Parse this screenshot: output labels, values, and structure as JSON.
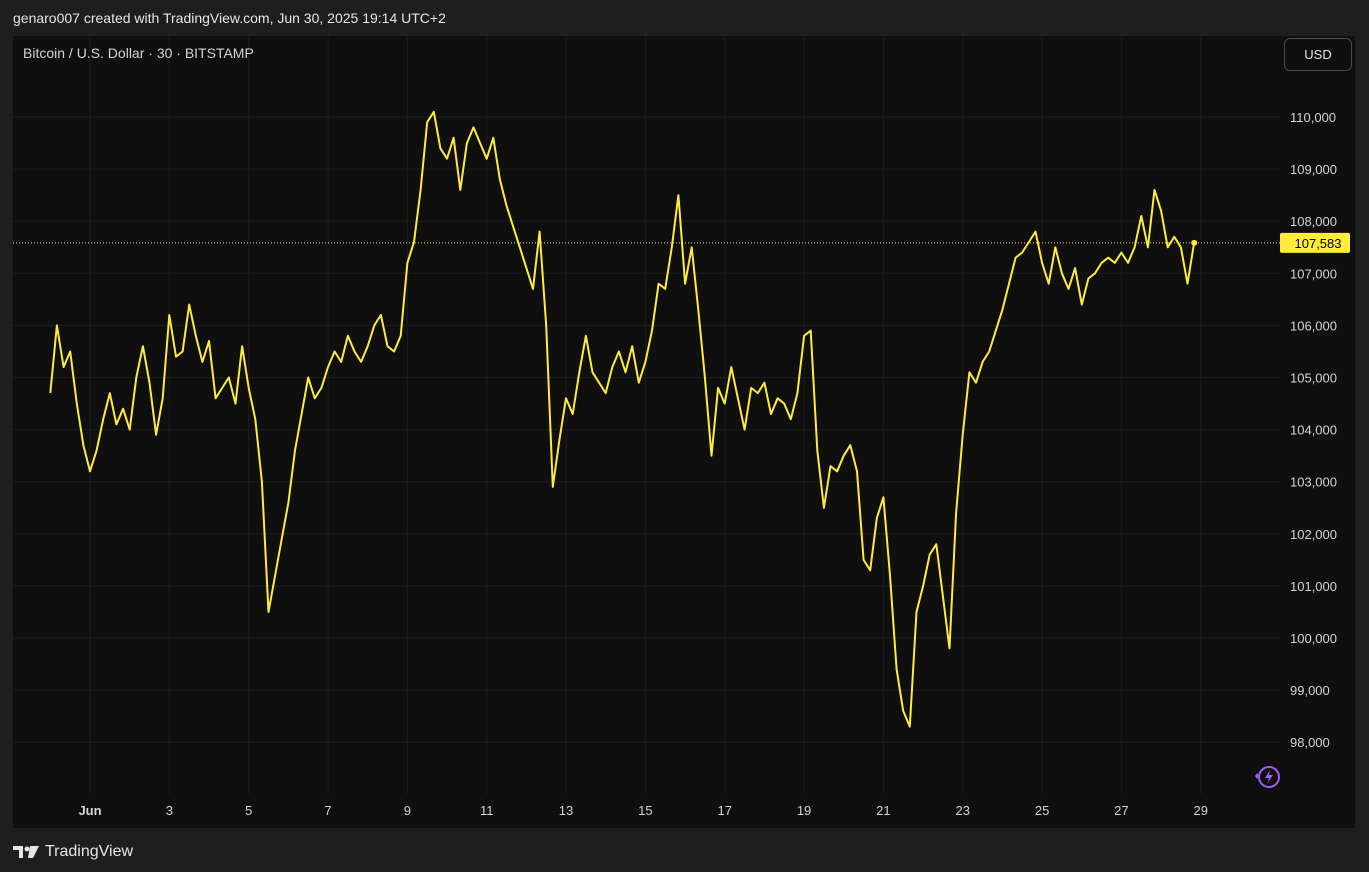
{
  "header": {
    "text": "genaro007 created with TradingView.com, Jun 30, 2025 19:14 UTC+2"
  },
  "chart_title": "Bitcoin / U.S. Dollar · 30 · BITSTAMP",
  "currency_button": "USD",
  "footer": {
    "brand": "TradingView"
  },
  "colors": {
    "line": "#ffeb3b",
    "background": "#0f0f0f",
    "frame": "#1e1e1e",
    "grid": "#1c1c1c",
    "text": "#d1d4dc",
    "price_tag": "#ffeb3b",
    "ai_icon": "#a45cf6"
  },
  "icons": [
    "tradingview-logo-icon",
    "ai-assistant-icon"
  ],
  "chart_data": {
    "type": "line",
    "x_axis_labels": [
      "Jun",
      "3",
      "5",
      "7",
      "9",
      "11",
      "13",
      "15",
      "17",
      "19",
      "21",
      "23",
      "25",
      "27",
      "29"
    ],
    "y_ticks": [
      98000,
      99000,
      100000,
      101000,
      102000,
      103000,
      104000,
      105000,
      106000,
      107000,
      108000,
      109000,
      110000
    ],
    "y_tick_labels": [
      "98,000",
      "99,000",
      "100,000",
      "101,000",
      "102,000",
      "103,000",
      "104,000",
      "105,000",
      "106,000",
      "107,000",
      "108,000",
      "109,000",
      "110,000"
    ],
    "ylim": [
      97000,
      111500
    ],
    "last_price": 107583,
    "last_price_label": "107,583",
    "grid": true,
    "series": [
      {
        "points": [
          [
            "2025-05-31 00:00",
            104700
          ],
          [
            "2025-05-31 04:00",
            106000
          ],
          [
            "2025-05-31 08:00",
            105200
          ],
          [
            "2025-05-31 12:00",
            105500
          ],
          [
            "2025-05-31 16:00",
            104500
          ],
          [
            "2025-05-31 20:00",
            103700
          ],
          [
            "2025-06-01 00:00",
            103200
          ],
          [
            "2025-06-01 04:00",
            103600
          ],
          [
            "2025-06-01 08:00",
            104200
          ],
          [
            "2025-06-01 12:00",
            104700
          ],
          [
            "2025-06-01 16:00",
            104100
          ],
          [
            "2025-06-01 20:00",
            104400
          ],
          [
            "2025-06-02 00:00",
            104000
          ],
          [
            "2025-06-02 04:00",
            105000
          ],
          [
            "2025-06-02 08:00",
            105600
          ],
          [
            "2025-06-02 12:00",
            104900
          ],
          [
            "2025-06-02 16:00",
            103900
          ],
          [
            "2025-06-02 20:00",
            104600
          ],
          [
            "2025-06-03 00:00",
            106200
          ],
          [
            "2025-06-03 04:00",
            105400
          ],
          [
            "2025-06-03 08:00",
            105500
          ],
          [
            "2025-06-03 12:00",
            106400
          ],
          [
            "2025-06-03 16:00",
            105800
          ],
          [
            "2025-06-03 20:00",
            105300
          ],
          [
            "2025-06-04 00:00",
            105700
          ],
          [
            "2025-06-04 04:00",
            104600
          ],
          [
            "2025-06-04 08:00",
            104800
          ],
          [
            "2025-06-04 12:00",
            105000
          ],
          [
            "2025-06-04 16:00",
            104500
          ],
          [
            "2025-06-04 20:00",
            105600
          ],
          [
            "2025-06-05 00:00",
            104800
          ],
          [
            "2025-06-05 04:00",
            104200
          ],
          [
            "2025-06-05 08:00",
            103000
          ],
          [
            "2025-06-05 12:00",
            100500
          ],
          [
            "2025-06-05 16:00",
            101200
          ],
          [
            "2025-06-05 20:00",
            101900
          ],
          [
            "2025-06-06 00:00",
            102600
          ],
          [
            "2025-06-06 04:00",
            103600
          ],
          [
            "2025-06-06 08:00",
            104300
          ],
          [
            "2025-06-06 12:00",
            105000
          ],
          [
            "2025-06-06 16:00",
            104600
          ],
          [
            "2025-06-06 20:00",
            104800
          ],
          [
            "2025-06-07 00:00",
            105200
          ],
          [
            "2025-06-07 04:00",
            105500
          ],
          [
            "2025-06-07 08:00",
            105300
          ],
          [
            "2025-06-07 12:00",
            105800
          ],
          [
            "2025-06-07 16:00",
            105500
          ],
          [
            "2025-06-07 20:00",
            105300
          ],
          [
            "2025-06-08 00:00",
            105600
          ],
          [
            "2025-06-08 04:00",
            106000
          ],
          [
            "2025-06-08 08:00",
            106200
          ],
          [
            "2025-06-08 12:00",
            105600
          ],
          [
            "2025-06-08 16:00",
            105500
          ],
          [
            "2025-06-08 20:00",
            105800
          ],
          [
            "2025-06-09 00:00",
            107200
          ],
          [
            "2025-06-09 04:00",
            107600
          ],
          [
            "2025-06-09 08:00",
            108600
          ],
          [
            "2025-06-09 12:00",
            109900
          ],
          [
            "2025-06-09 16:00",
            110100
          ],
          [
            "2025-06-09 20:00",
            109400
          ],
          [
            "2025-06-10 00:00",
            109200
          ],
          [
            "2025-06-10 04:00",
            109600
          ],
          [
            "2025-06-10 08:00",
            108600
          ],
          [
            "2025-06-10 12:00",
            109500
          ],
          [
            "2025-06-10 16:00",
            109800
          ],
          [
            "2025-06-10 20:00",
            109500
          ],
          [
            "2025-06-11 00:00",
            109200
          ],
          [
            "2025-06-11 04:00",
            109600
          ],
          [
            "2025-06-11 08:00",
            108800
          ],
          [
            "2025-06-11 12:00",
            108300
          ],
          [
            "2025-06-11 16:00",
            107900
          ],
          [
            "2025-06-11 20:00",
            107500
          ],
          [
            "2025-06-12 00:00",
            107100
          ],
          [
            "2025-06-12 04:00",
            106700
          ],
          [
            "2025-06-12 08:00",
            107800
          ],
          [
            "2025-06-12 12:00",
            106000
          ],
          [
            "2025-06-12 16:00",
            102900
          ],
          [
            "2025-06-12 20:00",
            103800
          ],
          [
            "2025-06-13 00:00",
            104600
          ],
          [
            "2025-06-13 04:00",
            104300
          ],
          [
            "2025-06-13 08:00",
            105100
          ],
          [
            "2025-06-13 12:00",
            105800
          ],
          [
            "2025-06-13 16:00",
            105100
          ],
          [
            "2025-06-13 20:00",
            104900
          ],
          [
            "2025-06-14 00:00",
            104700
          ],
          [
            "2025-06-14 04:00",
            105200
          ],
          [
            "2025-06-14 08:00",
            105500
          ],
          [
            "2025-06-14 12:00",
            105100
          ],
          [
            "2025-06-14 16:00",
            105600
          ],
          [
            "2025-06-14 20:00",
            104900
          ],
          [
            "2025-06-15 00:00",
            105300
          ],
          [
            "2025-06-15 04:00",
            105900
          ],
          [
            "2025-06-15 08:00",
            106800
          ],
          [
            "2025-06-15 12:00",
            106700
          ],
          [
            "2025-06-15 16:00",
            107500
          ],
          [
            "2025-06-15 20:00",
            108500
          ],
          [
            "2025-06-16 00:00",
            106800
          ],
          [
            "2025-06-16 04:00",
            107500
          ],
          [
            "2025-06-16 08:00",
            106300
          ],
          [
            "2025-06-16 12:00",
            105000
          ],
          [
            "2025-06-16 16:00",
            103500
          ],
          [
            "2025-06-16 20:00",
            104800
          ],
          [
            "2025-06-17 00:00",
            104500
          ],
          [
            "2025-06-17 04:00",
            105200
          ],
          [
            "2025-06-17 08:00",
            104600
          ],
          [
            "2025-06-17 12:00",
            104000
          ],
          [
            "2025-06-17 16:00",
            104800
          ],
          [
            "2025-06-17 20:00",
            104700
          ],
          [
            "2025-06-18 00:00",
            104900
          ],
          [
            "2025-06-18 04:00",
            104300
          ],
          [
            "2025-06-18 08:00",
            104600
          ],
          [
            "2025-06-18 12:00",
            104500
          ],
          [
            "2025-06-18 16:00",
            104200
          ],
          [
            "2025-06-18 20:00",
            104700
          ],
          [
            "2025-06-19 00:00",
            105800
          ],
          [
            "2025-06-19 04:00",
            105900
          ],
          [
            "2025-06-19 08:00",
            103600
          ],
          [
            "2025-06-19 12:00",
            102500
          ],
          [
            "2025-06-19 16:00",
            103300
          ],
          [
            "2025-06-19 20:00",
            103200
          ],
          [
            "2025-06-20 00:00",
            103500
          ],
          [
            "2025-06-20 04:00",
            103700
          ],
          [
            "2025-06-20 08:00",
            103200
          ],
          [
            "2025-06-20 12:00",
            101500
          ],
          [
            "2025-06-20 16:00",
            101300
          ],
          [
            "2025-06-20 20:00",
            102300
          ],
          [
            "2025-06-21 00:00",
            102700
          ],
          [
            "2025-06-21 04:00",
            101200
          ],
          [
            "2025-06-21 08:00",
            99400
          ],
          [
            "2025-06-21 12:00",
            98600
          ],
          [
            "2025-06-21 16:00",
            98300
          ],
          [
            "2025-06-21 20:00",
            100500
          ],
          [
            "2025-06-22 00:00",
            101000
          ],
          [
            "2025-06-22 04:00",
            101600
          ],
          [
            "2025-06-22 08:00",
            101800
          ],
          [
            "2025-06-22 12:00",
            100800
          ],
          [
            "2025-06-22 16:00",
            99800
          ],
          [
            "2025-06-22 20:00",
            102400
          ],
          [
            "2025-06-23 00:00",
            103900
          ],
          [
            "2025-06-23 04:00",
            105100
          ],
          [
            "2025-06-23 08:00",
            104900
          ],
          [
            "2025-06-23 12:00",
            105300
          ],
          [
            "2025-06-23 16:00",
            105500
          ],
          [
            "2025-06-23 20:00",
            105900
          ],
          [
            "2025-06-24 00:00",
            106300
          ],
          [
            "2025-06-24 04:00",
            106800
          ],
          [
            "2025-06-24 08:00",
            107300
          ],
          [
            "2025-06-24 12:00",
            107400
          ],
          [
            "2025-06-24 16:00",
            107600
          ],
          [
            "2025-06-24 20:00",
            107800
          ],
          [
            "2025-06-25 00:00",
            107200
          ],
          [
            "2025-06-25 04:00",
            106800
          ],
          [
            "2025-06-25 08:00",
            107500
          ],
          [
            "2025-06-25 12:00",
            107000
          ],
          [
            "2025-06-25 16:00",
            106700
          ],
          [
            "2025-06-25 20:00",
            107100
          ],
          [
            "2025-06-26 00:00",
            106400
          ],
          [
            "2025-06-26 04:00",
            106900
          ],
          [
            "2025-06-26 08:00",
            107000
          ],
          [
            "2025-06-26 12:00",
            107200
          ],
          [
            "2025-06-26 16:00",
            107300
          ],
          [
            "2025-06-26 20:00",
            107200
          ],
          [
            "2025-06-27 00:00",
            107400
          ],
          [
            "2025-06-27 04:00",
            107200
          ],
          [
            "2025-06-27 08:00",
            107500
          ],
          [
            "2025-06-27 12:00",
            108100
          ],
          [
            "2025-06-27 16:00",
            107500
          ],
          [
            "2025-06-27 20:00",
            108600
          ],
          [
            "2025-06-28 00:00",
            108200
          ],
          [
            "2025-06-28 04:00",
            107500
          ],
          [
            "2025-06-28 08:00",
            107700
          ],
          [
            "2025-06-28 12:00",
            107500
          ],
          [
            "2025-06-28 16:00",
            106800
          ],
          [
            "2025-06-28 20:00",
            107583
          ]
        ]
      }
    ]
  }
}
